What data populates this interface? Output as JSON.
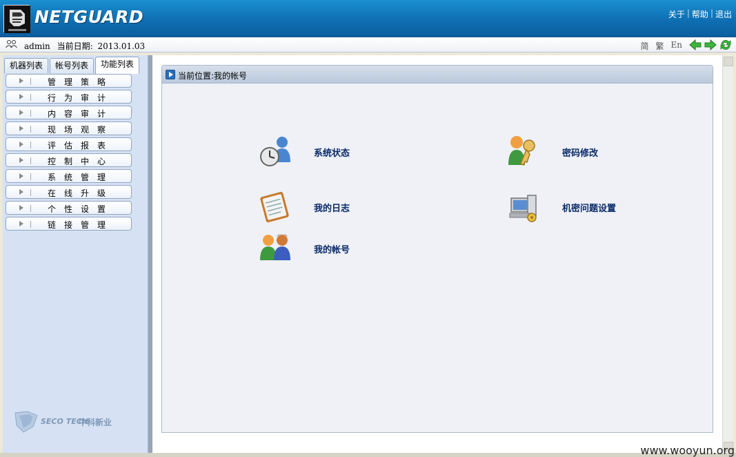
{
  "header": {
    "title": "NETGUARD",
    "links": [
      "关于",
      "帮助",
      "退出"
    ]
  },
  "infobar": {
    "user": "admin",
    "date_label": "当前日期:",
    "date": "2013.01.03",
    "languages": [
      "简",
      "繁",
      "En"
    ]
  },
  "sidebar": {
    "tabs": [
      "机器列表",
      "帐号列表",
      "功能列表"
    ],
    "active_tab": "功能列表",
    "items": [
      {
        "label": "管理策略"
      },
      {
        "label": "行为审计"
      },
      {
        "label": "内容审计"
      },
      {
        "label": "现场观察"
      },
      {
        "label": "评估报表"
      },
      {
        "label": "控制中心"
      },
      {
        "label": "系统管理"
      },
      {
        "label": "在线升级"
      },
      {
        "label": "个性设置"
      },
      {
        "label": "链接管理"
      }
    ],
    "brand_en": "SECO TECH",
    "brand_cn": "中科新业"
  },
  "main": {
    "location": "当前位置:我的帐号",
    "items": [
      {
        "label": "系统状态",
        "icon": "clock-user-icon"
      },
      {
        "label": "密码修改",
        "icon": "user-key-icon"
      },
      {
        "label": "我的日志",
        "icon": "notepad-icon"
      },
      {
        "label": "机密问题设置",
        "icon": "computer-settings-icon"
      },
      {
        "label": "我的帐号",
        "icon": "users-icon"
      }
    ]
  },
  "footer": {
    "watermark": "www.wooyun.org"
  },
  "colors": {
    "header": "#0f6fb3",
    "sidebar": "#d6e2f4",
    "label": "#0a2a6a"
  }
}
